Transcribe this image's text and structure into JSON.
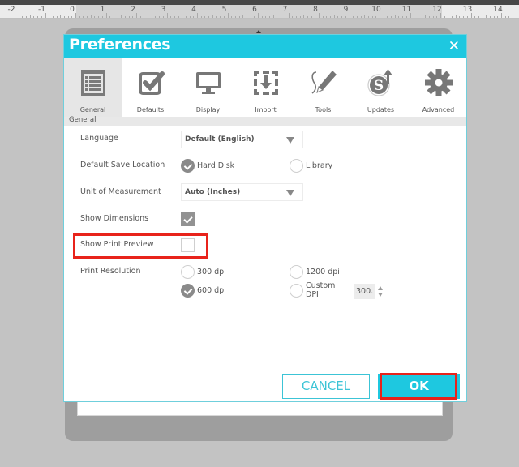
{
  "ruler": {
    "labels": [
      "-2",
      "-1",
      "0",
      "1",
      "2",
      "3",
      "4",
      "5",
      "6",
      "7",
      "8",
      "9",
      "10",
      "11",
      "12",
      "13",
      "14"
    ]
  },
  "dialog": {
    "title": "Preferences",
    "close_icon": "close-icon",
    "tabs": [
      {
        "label": "General",
        "icon": "list-document-icon",
        "selected": true
      },
      {
        "label": "Defaults",
        "icon": "checkbox-check-icon",
        "selected": false
      },
      {
        "label": "Display",
        "icon": "monitor-icon",
        "selected": false
      },
      {
        "label": "Import",
        "icon": "import-arrow-icon",
        "selected": false
      },
      {
        "label": "Tools",
        "icon": "pencil-icon",
        "selected": false
      },
      {
        "label": "Updates",
        "icon": "silhouette-update-icon",
        "selected": false
      },
      {
        "label": "Advanced",
        "icon": "gear-icon",
        "selected": false
      }
    ],
    "section_title": "General",
    "settings": {
      "language": {
        "label": "Language",
        "value": "Default (English)"
      },
      "save_location": {
        "label": "Default Save Location",
        "options": [
          {
            "label": "Hard Disk",
            "checked": true
          },
          {
            "label": "Library",
            "checked": false
          }
        ]
      },
      "unit": {
        "label": "Unit of Measurement",
        "value": "Auto (Inches)"
      },
      "show_dimensions": {
        "label": "Show Dimensions",
        "checked": true
      },
      "show_print_preview": {
        "label": "Show Print Preview",
        "checked": false
      },
      "print_resolution": {
        "label": "Print Resolution",
        "options": [
          {
            "label": "300 dpi",
            "checked": false
          },
          {
            "label": "1200 dpi",
            "checked": false
          },
          {
            "label": "600 dpi",
            "checked": true
          },
          {
            "label_line1": "Custom",
            "label_line2": "DPI",
            "checked": false
          }
        ],
        "custom_dpi_value": "300."
      }
    },
    "buttons": {
      "cancel": "CANCEL",
      "ok": "OK"
    }
  },
  "colors": {
    "accent": "#1ec8e0",
    "highlight": "#e8231b"
  }
}
